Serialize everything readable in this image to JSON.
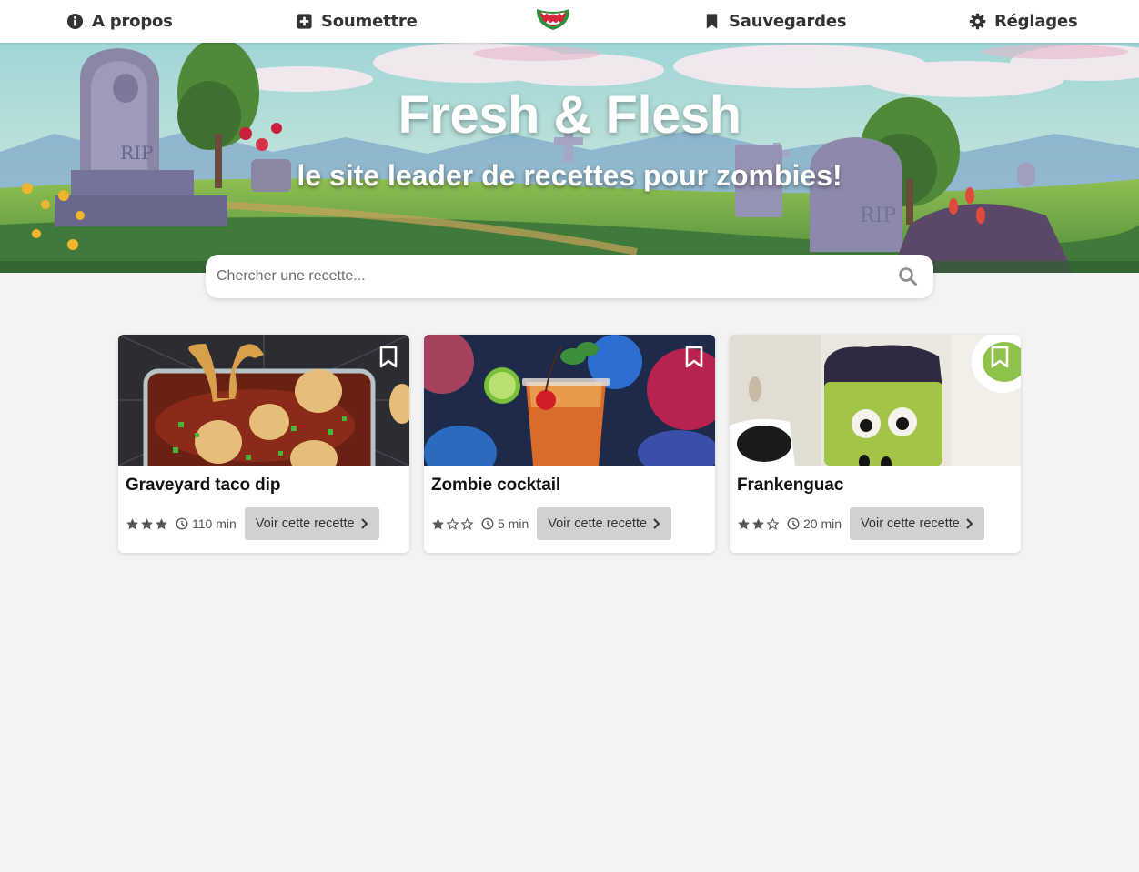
{
  "nav": {
    "about": "A propos",
    "submit": "Soumettre",
    "saved": "Sauvegardes",
    "settings": "Réglages",
    "icons": {
      "about": "info-circle-icon",
      "submit": "plus-square-icon",
      "saved": "bookmark-icon",
      "settings": "gear-icon",
      "logo": "zombie-mouth-logo"
    }
  },
  "hero": {
    "title": "Fresh & Flesh",
    "subtitle": "le site leader de recettes pour zombies!"
  },
  "search": {
    "placeholder": "Chercher une recette...",
    "icon": "search-icon"
  },
  "recipes": [
    {
      "title": "Graveyard taco dip",
      "rating": 3,
      "rating_max": 3,
      "time": "110 min",
      "cta": "Voir cette recette"
    },
    {
      "title": "Zombie cocktail",
      "rating": 1,
      "rating_max": 3,
      "time": "5 min",
      "cta": "Voir cette recette"
    },
    {
      "title": "Frankenguac",
      "rating": 2,
      "rating_max": 3,
      "time": "20 min",
      "cta": "Voir cette recette"
    }
  ],
  "colors": {
    "page_bg": "#f3f3f3",
    "nav_text": "#333333",
    "button_bg": "#d1d1d3",
    "logo_green": "#2f8f3e",
    "logo_red": "#d8253a",
    "star": "#555555"
  }
}
